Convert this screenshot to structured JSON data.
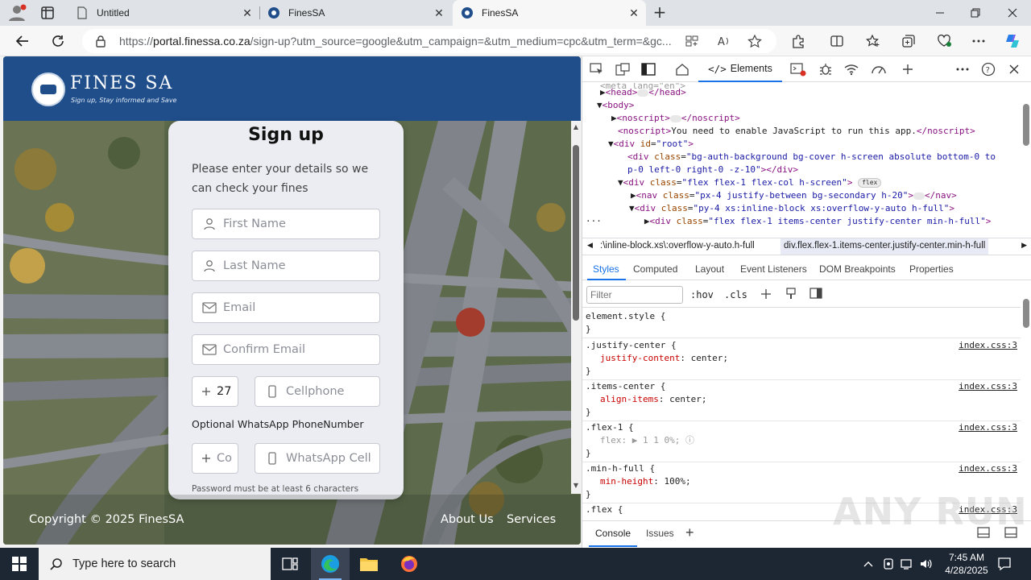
{
  "browser": {
    "tabs": [
      {
        "title": "Untitled",
        "icon": "page-icon"
      },
      {
        "title": "FinesSA",
        "icon": "finessa-favicon"
      },
      {
        "title": "FinesSA",
        "icon": "finessa-favicon",
        "active": true
      }
    ],
    "url_prefix": "https://",
    "url_host": "portal.finessa.co.za",
    "url_rest": "/sign-up?utm_source=google&utm_campaign=&utm_medium=cpc&utm_term=&gc..."
  },
  "site": {
    "brand": "FINES SA",
    "tagline": "Sign up, Stay informed and Save",
    "form": {
      "title": "Sign up",
      "subtitle": "Please enter your details so we can check your fines",
      "first_name_placeholder": "First Name",
      "last_name_placeholder": "Last Name",
      "email_placeholder": "Email",
      "confirm_email_placeholder": "Confirm Email",
      "country_code_value": "27",
      "cellphone_placeholder": "Cellphone",
      "whatsapp_label": "Optional WhatsApp PhoneNumber",
      "wa_code_placeholder": "Co",
      "whatsapp_placeholder": "WhatsApp Cell",
      "password_note": "Password must be at least 6 characters"
    },
    "footer": {
      "copyright": "Copyright © 2025 FinesSA",
      "links": [
        "About Us",
        "Services"
      ]
    }
  },
  "devtools": {
    "main_tab": "Elements",
    "dom_lines": {
      "head_open": "<head>",
      "head_close": "</head>",
      "body": "<body>",
      "noscript1_open": "<noscript>",
      "noscript1_close": "</noscript>",
      "noscript2_text": "You need to enable JavaScript to run this app.",
      "root_id": "root",
      "bg_class_1": "bg-auth-background bg-cover h-screen absolute bottom-0 to",
      "bg_class_2": "p-0 left-0 right-0 -z-10",
      "flex_class": "flex flex-1 flex-col h-screen",
      "flex_badge": "flex",
      "nav_class": "px-4 justify-between bg-secondary h-20",
      "py_class": "py-4 xs:inline-block xs:overflow-y-auto h-full",
      "sel_class": "flex flex-1 items-center justify-center min-h-full"
    },
    "breadcrumbs": [
      ":\\inline-block.xs\\:overflow-y-auto.h-full",
      "div.flex.flex-1.items-center.justify-center.min-h-full"
    ],
    "sub_tabs": [
      "Styles",
      "Computed",
      "Layout",
      "Event Listeners",
      "DOM Breakpoints",
      "Properties"
    ],
    "filter_placeholder": "Filter",
    "filter_buttons": [
      ":hov",
      ".cls"
    ],
    "style_rules": [
      {
        "selector": "element.style {",
        "decls": [],
        "source": ""
      },
      {
        "selector": ".justify-center {",
        "decls": [
          {
            "prop": "justify-content",
            "value": "center;"
          }
        ],
        "source": "index.css:3"
      },
      {
        "selector": ".items-center {",
        "decls": [
          {
            "prop": "align-items",
            "value": "center;"
          }
        ],
        "source": "index.css:3"
      },
      {
        "selector": ".flex-1 {",
        "decls": [
          {
            "prop": "flex",
            "value": "▶ 1 1 0%;"
          }
        ],
        "source": "index.css:3"
      },
      {
        "selector": ".min-h-full {",
        "decls": [
          {
            "prop": "min-height",
            "value": "100%;"
          }
        ],
        "source": "index.css:3"
      },
      {
        "selector": ".flex {",
        "decls": [],
        "source": "index.css:3"
      }
    ],
    "drawer_tabs": [
      "Console",
      "Issues"
    ]
  },
  "watermark": "ANY RUN",
  "taskbar": {
    "search_placeholder": "Type here to search",
    "time": "7:45 AM",
    "date": "4/28/2025"
  },
  "colors": {
    "site_nav": "#1f4e8b",
    "devtools_accent": "#1a73e8",
    "taskbar": "#1d2633"
  }
}
